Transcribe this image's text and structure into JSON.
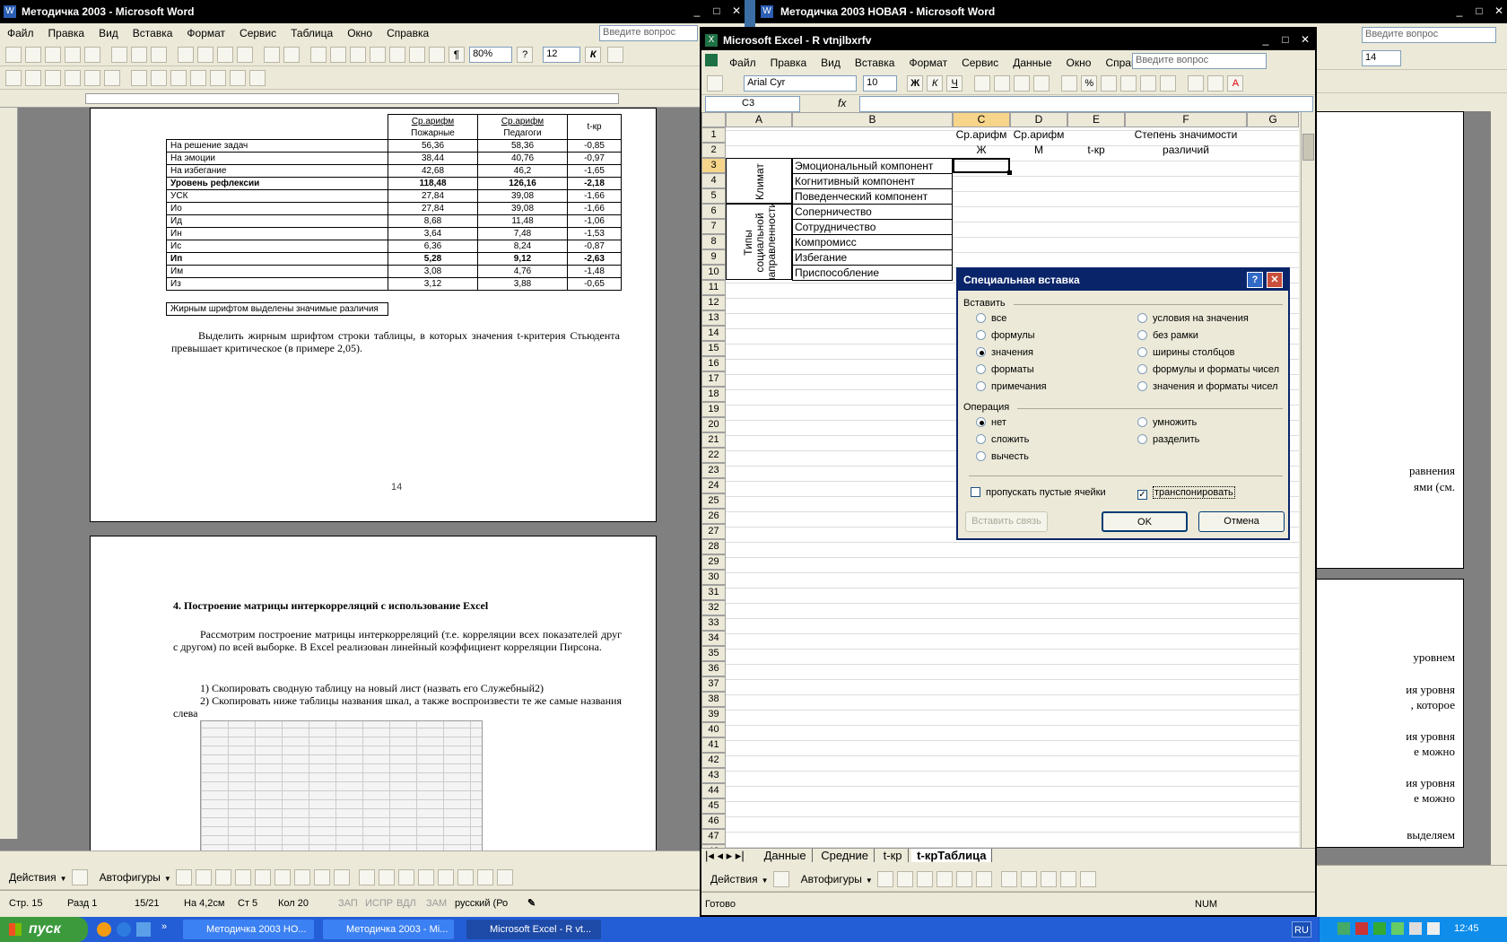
{
  "word_left": {
    "title": "Методичка 2003 - Microsoft Word",
    "menu": [
      "Файл",
      "Правка",
      "Вид",
      "Вставка",
      "Формат",
      "Сервис",
      "Таблица",
      "Окно",
      "Справка"
    ],
    "help_placeholder": "Введите вопрос",
    "zoom": "80%",
    "font_size": "12",
    "table_head": {
      "c1a": "Ср.арифм",
      "c1b": "Пожарные",
      "c2a": "Ср.арифм",
      "c2b": "Педагоги",
      "c3": "t-кр"
    },
    "table_rows": [
      [
        "На решение задач",
        "56,36",
        "58,36",
        "-0,85"
      ],
      [
        "На эмоции",
        "38,44",
        "40,76",
        "-0,97"
      ],
      [
        "На избегание",
        "42,68",
        "46,2",
        "-1,65"
      ],
      [
        "Уровень рефлексии",
        "118,48",
        "126,16",
        "-2,18"
      ],
      [
        "УСК",
        "27,84",
        "39,08",
        "-1,66"
      ],
      [
        "Ио",
        "27,84",
        "39,08",
        "-1,66"
      ],
      [
        "Ид",
        "8,68",
        "11,48",
        "-1,06"
      ],
      [
        "Ин",
        "3,64",
        "7,48",
        "-1,53"
      ],
      [
        "Ис",
        "6,36",
        "8,24",
        "-0,87"
      ],
      [
        "Ип",
        "5,28",
        "9,12",
        "-2,63"
      ],
      [
        "Им",
        "3,08",
        "4,76",
        "-1,48"
      ],
      [
        "Из",
        "3,12",
        "3,88",
        "-0,65"
      ]
    ],
    "table_note": "Жирным шрифтом выделены значимые различия",
    "para1": "Выделить жирным шрифтом строки таблицы, в которых значения t-критерия Стьюдента превышает критическое (в примере 2,05).",
    "page_num": "14",
    "heading": "4. Построение матрицы интеркорреляций с использование Excel",
    "para2": "Рассмотрим построение матрицы интеркорреляций (т.е. корреляции всех показателей друг с другом) по всей выборке. В Excel реализован линейный коэффициент корреляции Пирсона.",
    "step1": "1) Скопировать сводную таблицу на новый лист (назвать его Служебный2)",
    "step2": "2) Скопировать ниже таблицы названия шкал, а также воспроизвести те же самые названия слева",
    "draw_actions": "Действия",
    "draw_autoshapes": "Автофигуры",
    "status": [
      "Стр. 15",
      "Разд 1",
      "15/21",
      "На 4,2см",
      "Ст 5",
      "Кол 20",
      "ЗАП",
      "ИСПР",
      "ВДЛ",
      "ЗАМ",
      "русский (Ро"
    ]
  },
  "word_right": {
    "title": "Методичка 2003 НОВАЯ - Microsoft Word",
    "help_placeholder": "Введите вопрос",
    "font_size": "14",
    "frag": [
      "равнения",
      "ями (см.",
      "уровнем",
      "ия уровня",
      ", которое",
      "ия уровня",
      "е можно",
      "ия уровня",
      "е можно",
      "выделяем"
    ]
  },
  "excel": {
    "title": "Microsoft Excel - R vtnjlbxrfv",
    "menu": [
      "Файл",
      "Правка",
      "Вид",
      "Вставка",
      "Формат",
      "Сервис",
      "Данные",
      "Окно",
      "Справка"
    ],
    "help_placeholder": "Введите вопрос",
    "font": "Arial Cyr",
    "size": "10",
    "namebox": "C3",
    "fx": "fx",
    "cols": [
      "A",
      "B",
      "C",
      "D",
      "E",
      "F",
      "G"
    ],
    "head_c": "Ср.арифм",
    "head_c2": "Ж",
    "head_d": "Ср.арифм",
    "head_d2": "М",
    "head_e2": "t-кр",
    "head_f": "Степень значимости",
    "head_f2": "различий",
    "group1": "Климат",
    "group2": "Типы социальной направленности",
    "rows_b": [
      "Эмоциональный компонент",
      "Когнитивный компонент",
      "Поведенческий компонент",
      "Соперничество",
      "Сотрудничество",
      "Компромисс",
      "Избегание",
      "Приспособление"
    ],
    "tabs": [
      "Данные",
      "Средние",
      "t-кр",
      "t-крТаблица"
    ],
    "status": "Готово",
    "num": "NUM"
  },
  "dialog": {
    "title": "Специальная вставка",
    "insert_label": "Вставить",
    "left_opts": [
      "все",
      "формулы",
      "значения",
      "форматы",
      "примечания"
    ],
    "right_opts": [
      "условия на значения",
      "без рамки",
      "ширины столбцов",
      "формулы и форматы чисел",
      "значения и форматы чисел"
    ],
    "op_label": "Операция",
    "op_left": [
      "нет",
      "сложить",
      "вычесть"
    ],
    "op_right": [
      "умножить",
      "разделить"
    ],
    "skip_blanks": "пропускать пустые ячейки",
    "transpose": "транспонировать",
    "paste_link": "Вставить связь",
    "ok": "OK",
    "cancel": "Отмена"
  },
  "taskbar": {
    "start": "пуск",
    "tasks": [
      "Методичка 2003 НО...",
      "Методичка 2003 - Mi...",
      "Microsoft Excel - R vt..."
    ],
    "lang": "RU",
    "clock": "12:45"
  }
}
